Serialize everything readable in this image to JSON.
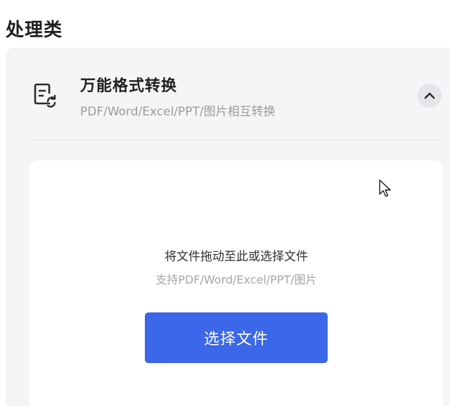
{
  "section": {
    "title": "处理类"
  },
  "tool": {
    "icon": "document-convert-icon",
    "title": "万能格式转换",
    "subtitle": "PDF/Word/Excel/PPT/图片相互转换",
    "collapse_icon": "chevron-up-icon"
  },
  "dropzone": {
    "text": "将文件拖动至此或选择文件",
    "hint": "支持PDF/Word/Excel/PPT/图片",
    "button_label": "选择文件"
  },
  "colors": {
    "accent": "#3b67e8",
    "card_bg": "#f4f5f7"
  }
}
